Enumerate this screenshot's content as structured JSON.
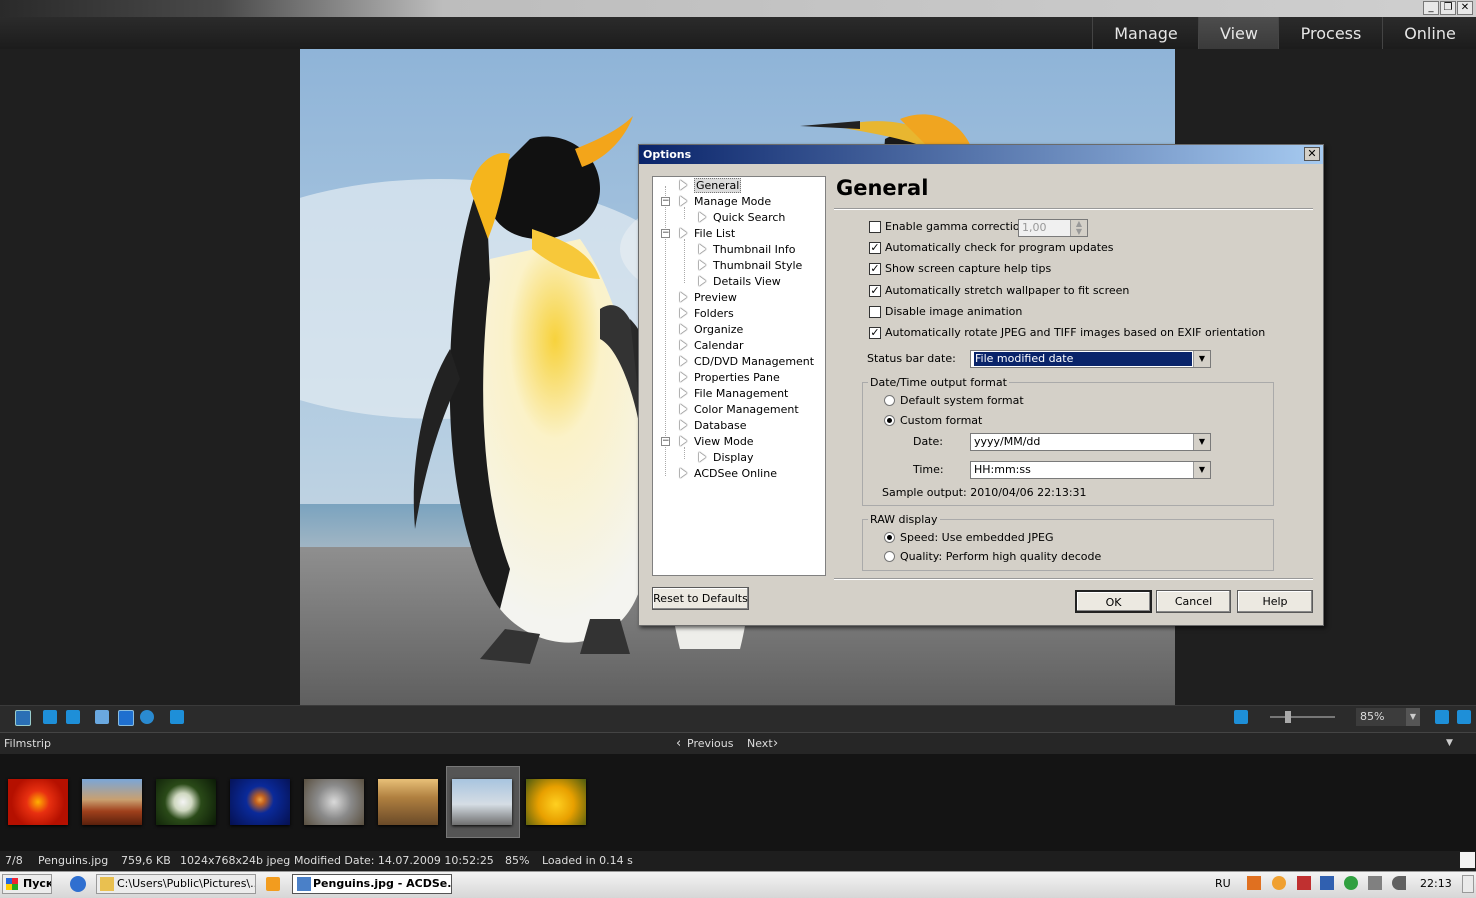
{
  "window": {
    "min": "_",
    "restore": "❐",
    "close": "✕"
  },
  "modes": [
    "Manage",
    "View",
    "Process",
    "Online"
  ],
  "active_mode": "View",
  "dialog": {
    "title": "Options",
    "close": "✕",
    "tree": [
      "General",
      "Manage Mode",
      "Quick Search",
      "File List",
      "Thumbnail Info",
      "Thumbnail Style",
      "Details View",
      "Preview",
      "Folders",
      "Organize",
      "Calendar",
      "CD/DVD Management",
      "Properties Pane",
      "File Management",
      "Color Management",
      "Database",
      "View Mode",
      "Display",
      "ACDSee Online"
    ],
    "heading": "General",
    "gamma_label": "Enable gamma correction:",
    "gamma_value": "1,00",
    "checkboxes": [
      {
        "label": "Automatically check for program updates",
        "checked": true
      },
      {
        "label": "Show screen capture help tips",
        "checked": true
      },
      {
        "label": "Automatically stretch wallpaper to fit screen",
        "checked": true
      },
      {
        "label": "Disable image animation",
        "checked": false
      },
      {
        "label": "Automatically rotate JPEG and TIFF images based on EXIF orientation",
        "checked": true
      }
    ],
    "status_bar_date_label": "Status bar date:",
    "status_bar_date_value": "File modified date",
    "datetime_group": "Date/Time output format",
    "default_format": "Default system format",
    "custom_format": "Custom format",
    "date_label": "Date:",
    "date_value": "yyyy/MM/dd",
    "time_label": "Time:",
    "time_value": "HH:mm:ss",
    "sample_output": "Sample output: 2010/04/06 22:13:31",
    "raw_group": "RAW display",
    "raw_speed": "Speed: Use embedded JPEG",
    "raw_quality": "Quality: Perform high quality decode",
    "reset": "Reset to Defaults",
    "ok": "OK",
    "cancel": "Cancel",
    "help": "Help"
  },
  "toolbar": {
    "zoom": "85%"
  },
  "filmstrip": {
    "label": "Filmstrip",
    "previous": "Previous",
    "next": "Next",
    "prev_glyph": "‹",
    "next_glyph": "›",
    "collapse_glyph": "▼"
  },
  "status": {
    "position": "7/8",
    "filename": "Penguins.jpg",
    "size": "759,6 KB",
    "dims": "1024x768x24b jpeg",
    "modified": "Modified Date: 14.07.2009 10:52:25",
    "zoom": "85%",
    "loaded": "Loaded in 0.14 s"
  },
  "taskbar": {
    "start": "Пуск",
    "explorer_task": "C:\\Users\\Public\\Pictures\\...",
    "acdsee_task": "Penguins.jpg - ACDSe...",
    "lang": "RU",
    "clock": "22:13"
  }
}
